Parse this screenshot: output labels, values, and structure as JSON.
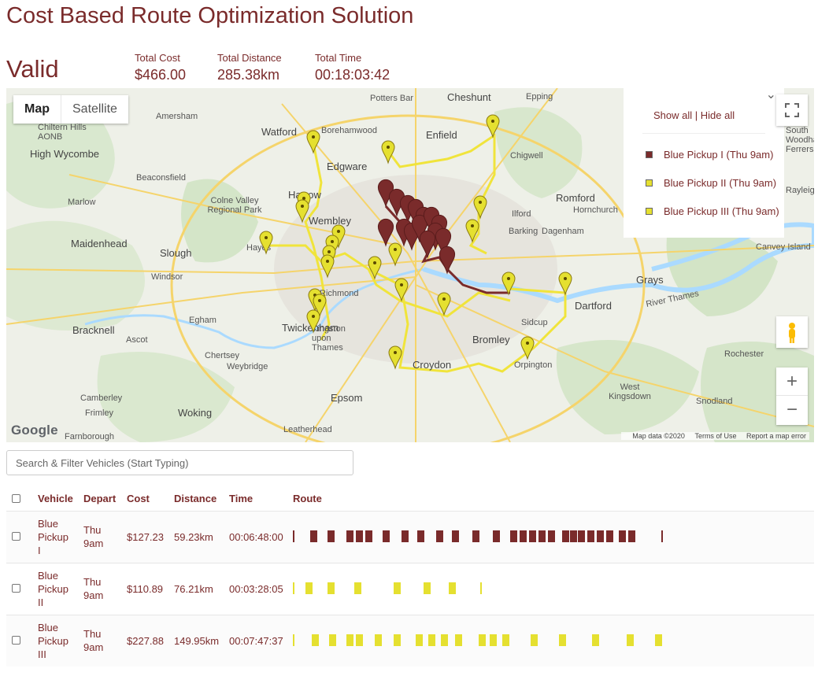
{
  "page": {
    "title": "Cost Based Route Optimization Solution",
    "status": "Valid"
  },
  "summary": {
    "total_cost_label": "Total Cost",
    "total_cost": "$466.00",
    "total_distance_label": "Total Distance",
    "total_distance": "285.38km",
    "total_time_label": "Total Time",
    "total_time": "00:18:03:42"
  },
  "map": {
    "type_map_label": "Map",
    "type_satellite_label": "Satellite",
    "google_logo": "Google",
    "attribution": {
      "data": "Map data ©2020",
      "terms": "Terms of Use",
      "report": "Report a map error"
    },
    "legend": {
      "show_all": "Show all",
      "divider": "|",
      "hide_all": "Hide all",
      "items": [
        {
          "label": "Blue Pickup I (Thu 9am)",
          "color": "#7a2b2b"
        },
        {
          "label": "Blue Pickup II (Thu 9am)",
          "color": "#e5e030"
        },
        {
          "label": "Blue Pickup III (Thu 9am)",
          "color": "#e5e030"
        }
      ]
    },
    "places": [
      "Watford",
      "Borehamwood",
      "Enfield",
      "Cheshunt",
      "Potters Bar",
      "Epping",
      "Chigwell",
      "Edgware",
      "Harrow",
      "Wembley",
      "Colne Valley Regional Park",
      "High Wycombe",
      "Chiltern Hills AONB",
      "Amersham",
      "Beaconsfield",
      "Marlow",
      "Maidenhead",
      "Slough",
      "Windsor",
      "Hayes",
      "Romford",
      "Hornchurch",
      "Ilford",
      "Barking",
      "Dagenham",
      "Canvey Island",
      "Grays",
      "River Thames",
      "Dartford",
      "Sidcup",
      "Bromley",
      "Orpington",
      "Croydon",
      "Epsom",
      "Richmond",
      "Twickenham",
      "Kingston upon Thames",
      "Egham",
      "Bracknell",
      "Ascot",
      "Chertsey",
      "Weybridge",
      "Woking",
      "Camberley",
      "Frimley",
      "Farnborough",
      "Leatherhead",
      "Rochester",
      "West Kingsdown",
      "Snodland",
      "South Woodham Ferrers",
      "Rayleigh"
    ],
    "colors": {
      "route1": "#7a2b2b",
      "route2": "#e5e030"
    }
  },
  "search": {
    "placeholder": "Search & Filter Vehicles (Start Typing)"
  },
  "table": {
    "columns": [
      "Vehicle",
      "Depart",
      "Cost",
      "Distance",
      "Time",
      "Route"
    ],
    "rows": [
      {
        "vehicle": [
          "Blue",
          "Pickup",
          "I"
        ],
        "depart": [
          "Thu",
          "9am"
        ],
        "cost": "$127.23",
        "distance": "59.23km",
        "time": "00:06:48:00",
        "color": "#7a2b2b"
      },
      {
        "vehicle": [
          "Blue",
          "Pickup",
          "II"
        ],
        "depart": [
          "Thu",
          "9am"
        ],
        "cost": "$110.89",
        "distance": "76.21km",
        "time": "00:03:28:05",
        "color": "#e5e030"
      },
      {
        "vehicle": [
          "Blue",
          "Pickup",
          "III"
        ],
        "depart": [
          "Thu",
          "9am"
        ],
        "cost": "$227.88",
        "distance": "149.95km",
        "time": "00:07:47:37",
        "color": "#e5e030"
      }
    ]
  }
}
